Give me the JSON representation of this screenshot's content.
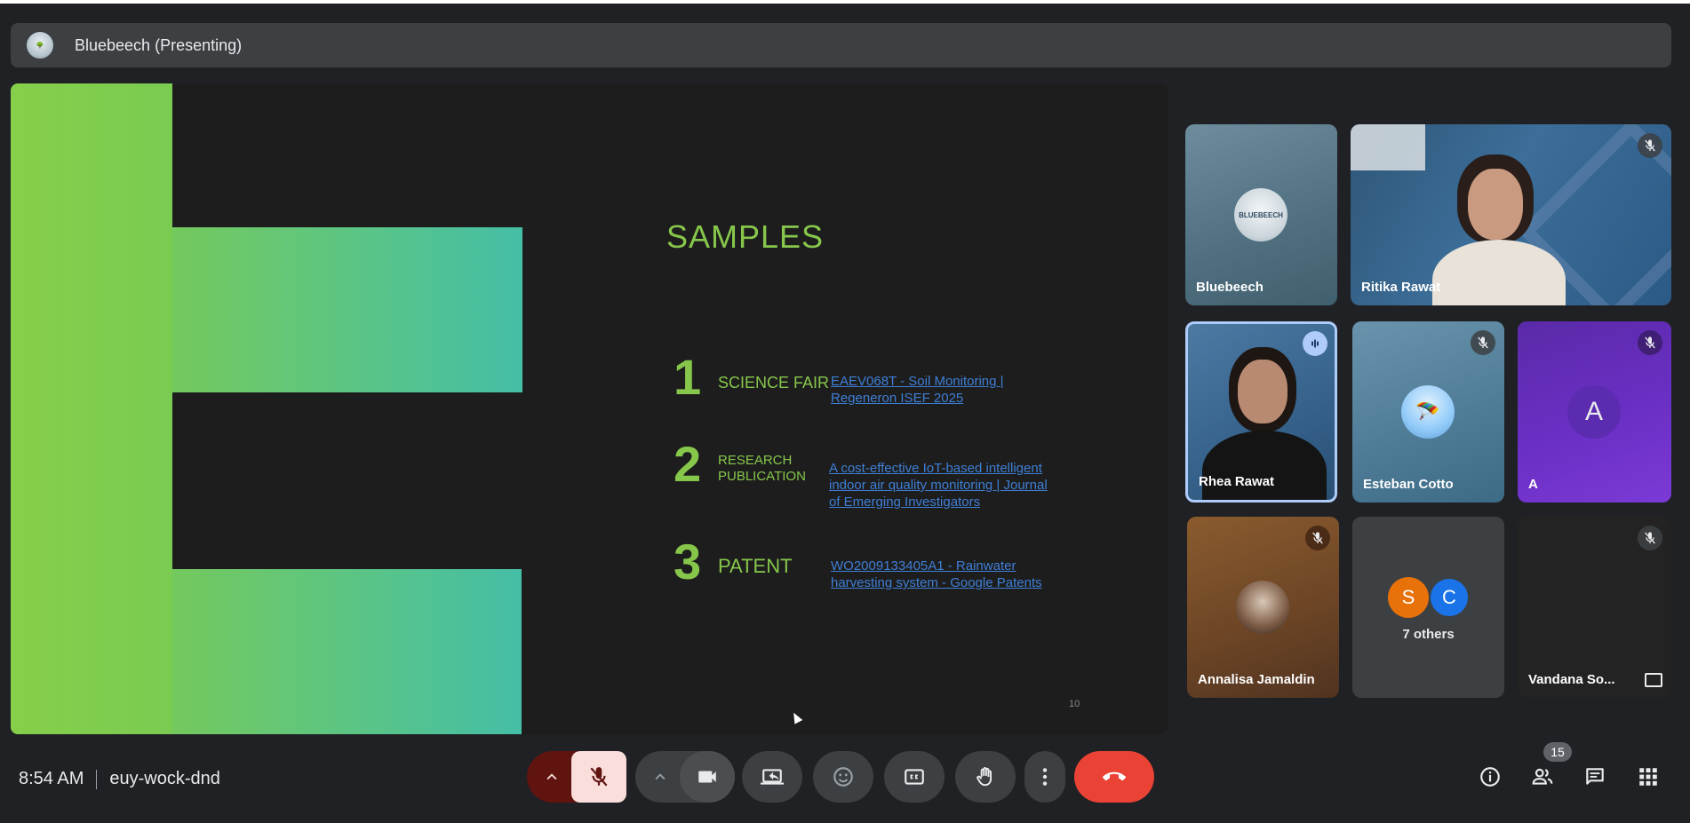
{
  "presenter": {
    "name": "Bluebeech (Presenting)",
    "avatar_text": "BLUEBEECH"
  },
  "slide": {
    "title": "SAMPLES",
    "page_number": "10",
    "samples": [
      {
        "number": "1",
        "label": "SCIENCE FAIR",
        "link": "EAEV068T - Soil Monitoring | Regeneron ISEF 2025"
      },
      {
        "number": "2",
        "label": "RESEARCH PUBLICATION",
        "link": "A cost-effective IoT-based intelligent indoor air quality monitoring | Journal of Emerging Investigators"
      },
      {
        "number": "3",
        "label": "PATENT",
        "link": "WO2009133405A1 - Rainwater harvesting system - Google Patents"
      }
    ]
  },
  "participants": [
    {
      "name": "Bluebeech",
      "muted": false,
      "avatar_text": "BLUEBEECH"
    },
    {
      "name": "Ritika Rawat",
      "muted": true
    },
    {
      "name": "Rhea Rawat",
      "muted": false,
      "speaking": true
    },
    {
      "name": "Esteban Cotto",
      "muted": true
    },
    {
      "name": "A",
      "muted": true,
      "initial": "A"
    },
    {
      "name": "Annalisa Jamaldin",
      "muted": true
    },
    {
      "name": "7 others",
      "initials": [
        "S",
        "C"
      ]
    },
    {
      "name": "Vandana So...",
      "muted": true
    }
  ],
  "bottom_bar": {
    "time": "8:54 AM",
    "meeting_code": "euy-wock-dnd",
    "people_count": "15"
  },
  "colors": {
    "background": "#202124",
    "accent_green": "#86c74b",
    "link_blue": "#3f7fd6",
    "end_call_red": "#ea4335",
    "mic_off_bg": "#f9dedc"
  },
  "icons": [
    "chevron-up-icon",
    "mic-off-icon",
    "camera-icon",
    "present-screen-icon",
    "emoji-icon",
    "captions-icon",
    "raise-hand-icon",
    "more-vert-icon",
    "end-call-icon",
    "info-icon",
    "people-icon",
    "chat-icon",
    "apps-grid-icon"
  ]
}
